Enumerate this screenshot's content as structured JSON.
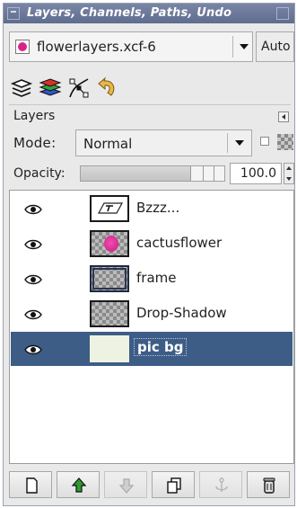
{
  "window": {
    "title": "Layers, Channels, Paths, Undo"
  },
  "image_selector": {
    "value": "flowerlayers.xcf-6",
    "auto_label": "Auto"
  },
  "tabs": [
    {
      "name": "layers",
      "icon": "layers-icon"
    },
    {
      "name": "channels",
      "icon": "channels-icon"
    },
    {
      "name": "paths",
      "icon": "paths-icon"
    },
    {
      "name": "undo",
      "icon": "undo-icon"
    }
  ],
  "panel": {
    "title": "Layers",
    "mode_label": "Mode:",
    "mode_value": "Normal",
    "opacity_label": "Opacity:",
    "opacity_value": "100.0",
    "opacity_percent": 100
  },
  "layers": [
    {
      "name": "Bzzz...",
      "thumb": "text",
      "visible": true,
      "selected": false
    },
    {
      "name": "cactusflower",
      "thumb": "flower",
      "visible": true,
      "selected": false
    },
    {
      "name": "frame",
      "thumb": "frame",
      "visible": true,
      "selected": false
    },
    {
      "name": "Drop-Shadow",
      "thumb": "shadow",
      "visible": true,
      "selected": false
    },
    {
      "name": "pic bg",
      "thumb": "bg",
      "visible": true,
      "selected": true
    }
  ],
  "toolbar": [
    {
      "name": "new-layer",
      "icon": "new-layer-icon",
      "enabled": true
    },
    {
      "name": "raise-layer",
      "icon": "arrow-up-icon",
      "enabled": true
    },
    {
      "name": "lower-layer",
      "icon": "arrow-down-icon",
      "enabled": false
    },
    {
      "name": "duplicate-layer",
      "icon": "duplicate-icon",
      "enabled": true
    },
    {
      "name": "anchor-layer",
      "icon": "anchor-icon",
      "enabled": false
    },
    {
      "name": "delete-layer",
      "icon": "trash-icon",
      "enabled": true
    }
  ],
  "colors": {
    "titlebar": "#5f6c8e",
    "selection": "#3d5d86"
  }
}
